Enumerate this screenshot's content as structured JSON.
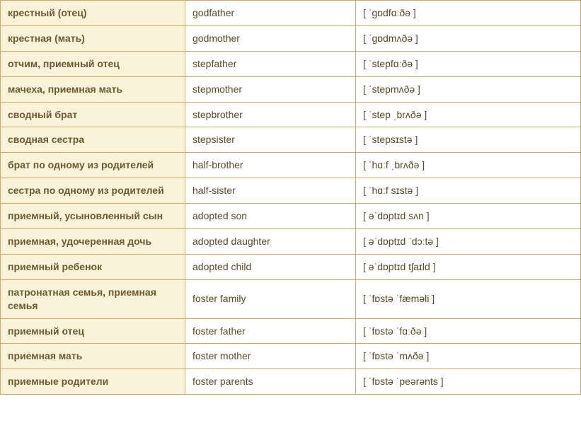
{
  "rows": [
    {
      "ru": "крестный (отец)",
      "en": "godfather",
      "ipa": "[ ˈɡɒdfɑːðə ]"
    },
    {
      "ru": "крестная (мать)",
      "en": "godmother",
      "ipa": "[ ˈɡɒdmʌðə ]"
    },
    {
      "ru": "отчим, приемный отец",
      "en": "stepfather",
      "ipa": "[ ˈstepfɑːðə ]"
    },
    {
      "ru": "мачеха, приемная мать",
      "en": "stepmother",
      "ipa": "[ ˈstepmʌðə ]"
    },
    {
      "ru": "сводный брат",
      "en": "stepbrother",
      "ipa": "[ ˈstep ˌbrʌðə ]"
    },
    {
      "ru": "сводная сестра",
      "en": "stepsister",
      "ipa": "[ ˈstepsɪstə ]"
    },
    {
      "ru": "брат по одному из родителей",
      "en": "half-brother",
      "ipa": "[ ˈhɑːf ˌbrʌðə ]"
    },
    {
      "ru": "сестра по одному из родителей",
      "en": "half-sister",
      "ipa": "[ ˈhɑːf sɪstə ]"
    },
    {
      "ru": "приемный, усыновленный сын",
      "en": "adopted son",
      "ipa": "[ əˈdɒptɪd sʌn ]"
    },
    {
      "ru": "приемная, удочеренная дочь",
      "en": "adopted daughter",
      "ipa": "[ əˈdɒptɪd ˈdɔːtə ]"
    },
    {
      "ru": "приемный ребенок",
      "en": "adopted child",
      "ipa": "[ əˈdɒptɪd tʃaɪld ]"
    },
    {
      "ru": "патронатная семья, приемная семья",
      "en": "foster family",
      "ipa": "[ ˈfɒstə ˈfæməli ]"
    },
    {
      "ru": "приемный отец",
      "en": "foster father",
      "ipa": "[ ˈfɒstə ˈfɑːðə ]"
    },
    {
      "ru": "приемная мать",
      "en": "foster mother",
      "ipa": "[ ˈfɒstə ˈmʌðə ]"
    },
    {
      "ru": "приемные родители",
      "en": "foster parents",
      "ipa": "[ ˈfɒstə ˈpeərənts ]"
    }
  ]
}
